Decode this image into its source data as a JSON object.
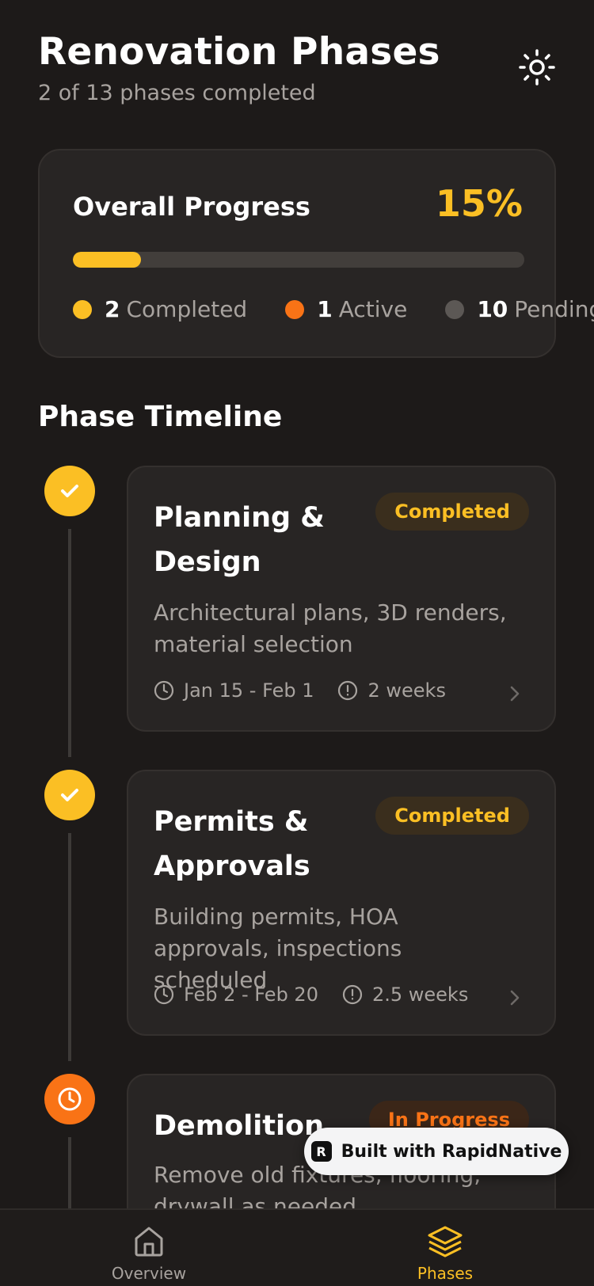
{
  "header": {
    "title": "Renovation Phases",
    "subtitle": "2 of 13 phases completed",
    "theme_icon": "sun-icon"
  },
  "progress": {
    "label": "Overall Progress",
    "percent_text": "15%",
    "fraction": 0.15,
    "legend": [
      {
        "count": "2",
        "label": "Completed",
        "color": "#fbbf24"
      },
      {
        "count": "1",
        "label": "Active",
        "color": "#f97316"
      },
      {
        "count": "10",
        "label": "Pending",
        "color": "#5c5855"
      }
    ]
  },
  "timeline": {
    "title": "Phase Timeline",
    "phases": [
      {
        "title": "Planning & Design",
        "status": "Completed",
        "description": "Architectural plans, 3D renders, material selection",
        "dates": "Jan 15 - Feb 1",
        "duration": "2 weeks",
        "node_icon": "check-icon"
      },
      {
        "title": "Permits & Approvals",
        "status": "Completed",
        "description": "Building permits, HOA approvals, inspections scheduled",
        "dates": "Feb 2 - Feb 20",
        "duration": "2.5 weeks",
        "node_icon": "check-icon"
      },
      {
        "title": "Demolition",
        "status": "In Progress",
        "description": "Remove old fixtures, flooring, drywall as needed",
        "node_icon": "clock-icon"
      }
    ]
  },
  "watermark": {
    "text": "Built with RapidNative"
  },
  "nav": {
    "items": [
      {
        "label": "Overview",
        "icon": "home-icon",
        "active": false
      },
      {
        "label": "Phases",
        "icon": "layers-icon",
        "active": true
      }
    ]
  },
  "colors": {
    "background": "#1d1a19",
    "card": "#282524",
    "accent": "#fbbf24",
    "active": "#f97316"
  }
}
